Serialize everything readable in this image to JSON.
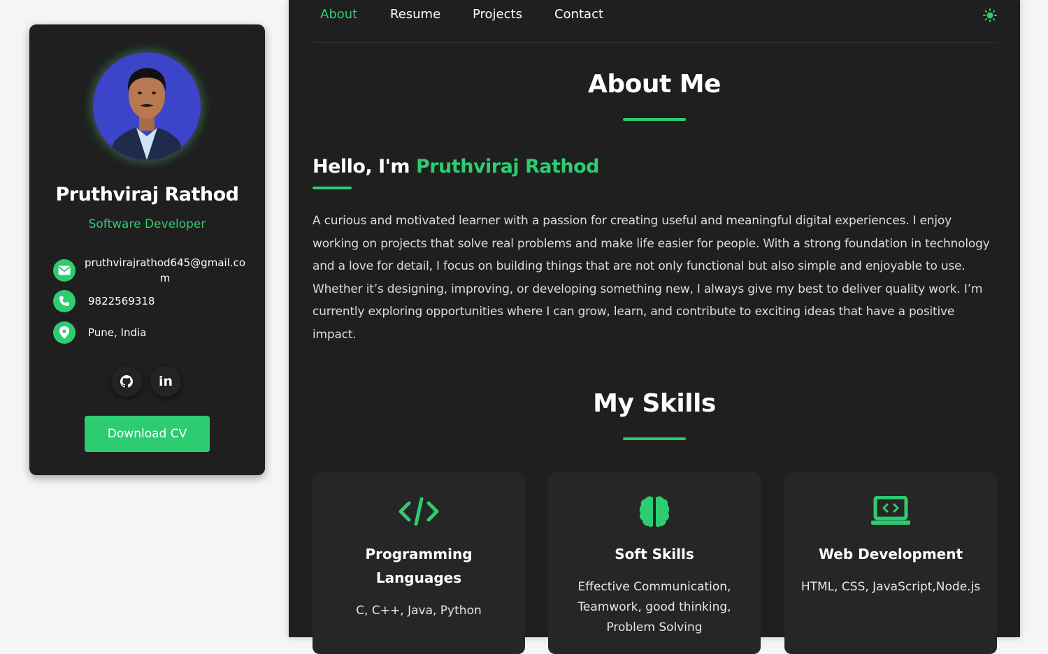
{
  "profile": {
    "name": "Pruthviraj Rathod",
    "role": "Software Developer",
    "email": "pruthvirajrathod645@gmail.com",
    "phone": "9822569318",
    "location": "Pune, India",
    "social": [
      "github-icon",
      "linkedin-icon"
    ],
    "linkedin_label": "in",
    "download_label": "Download CV"
  },
  "nav": {
    "items": [
      "About",
      "Resume",
      "Projects",
      "Contact"
    ],
    "active": "About",
    "theme_icon": "sun-icon"
  },
  "about": {
    "title": "About Me",
    "hello_prefix": "Hello, I'm",
    "hello_name": "Pruthviraj Rathod",
    "text": "A curious and motivated learner with a passion for creating useful and meaningful digital experiences. I enjoy working on projects that solve real problems and make life easier for people. With a strong foundation in technology and a love for detail, I focus on building things that are not only functional but also simple and enjoyable to use. Whether it’s designing, improving, or developing something new, I always give my best to deliver quality work. I’m currently exploring opportunities where I can grow, learn, and contribute to exciting ideas that have a positive impact."
  },
  "skills": {
    "title": "My Skills",
    "cards": [
      {
        "icon": "code-icon",
        "title": "Programming Languages",
        "desc": "C, C++, Java, Python"
      },
      {
        "icon": "brain-icon",
        "title": "Soft Skills",
        "desc": "Effective Communication, Teamwork, good thinking, Problem Solving"
      },
      {
        "icon": "laptop-code-icon",
        "title": "Web Development",
        "desc": "HTML, CSS, JavaScript,Node.js"
      }
    ]
  },
  "colors": {
    "accent": "#2ecc71",
    "panel": "#1f1f1f",
    "card": "#262626",
    "page": "#f5f5f5"
  }
}
